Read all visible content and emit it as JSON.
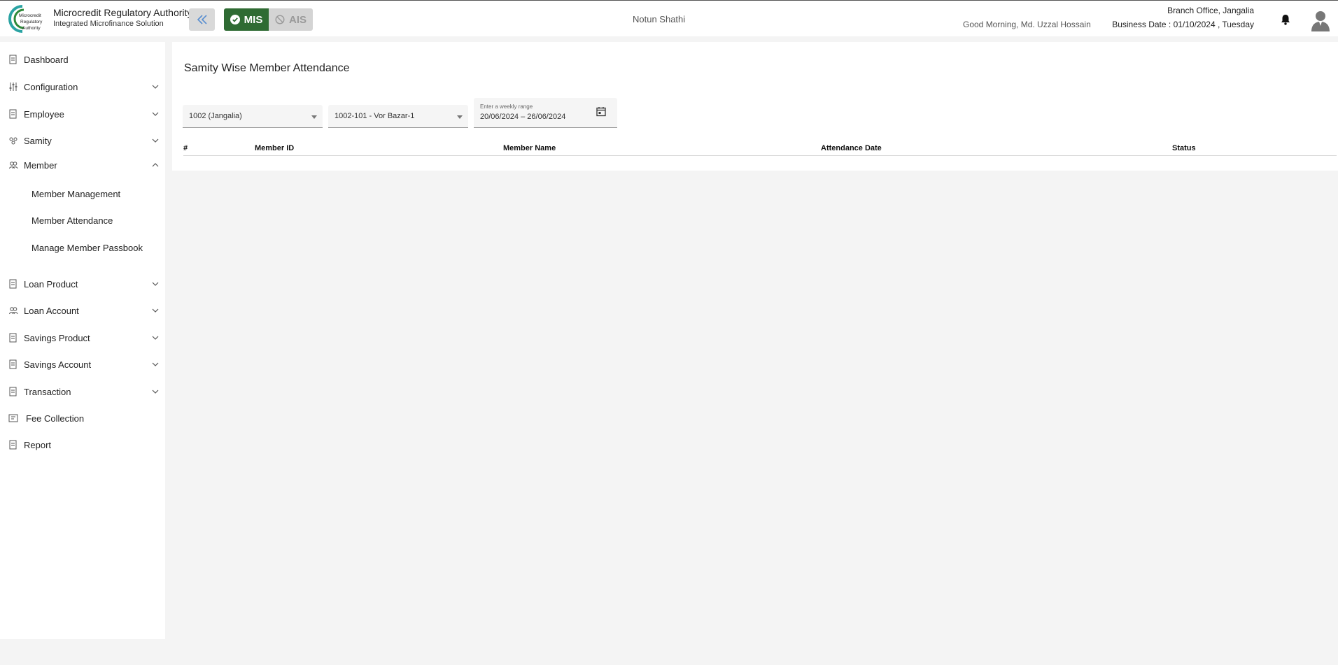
{
  "header": {
    "brand_title": "Microcredit Regulatory Authority",
    "brand_subtitle": "Integrated Microfinance Solution",
    "logo_text": [
      "Microcredit",
      "Regulatory",
      "Authority"
    ],
    "mode_mis": "MIS",
    "mode_ais": "AIS",
    "org_name": "Notun Shathi",
    "greeting": "Good Morning, Md. Uzzal Hossain",
    "branch": "Branch Office, Jangalia",
    "business_date": "Business Date : 01/10/2024 , Tuesday"
  },
  "sidebar": {
    "items": [
      {
        "label": "Dashboard"
      },
      {
        "label": "Configuration"
      },
      {
        "label": "Employee"
      },
      {
        "label": "Samity"
      },
      {
        "label": "Member"
      },
      {
        "label": "Loan Product"
      },
      {
        "label": "Loan Account"
      },
      {
        "label": "Savings Product"
      },
      {
        "label": "Savings Account"
      },
      {
        "label": "Transaction"
      },
      {
        "label": "Fee Collection"
      },
      {
        "label": "Report"
      }
    ],
    "member_sub": [
      {
        "label": "Member Management"
      },
      {
        "label": "Member Attendance"
      },
      {
        "label": "Manage Member Passbook"
      }
    ]
  },
  "main": {
    "title": "Samity Wise Member Attendance",
    "branch_select": "1002 (Jangalia)",
    "samity_select": "1002-101 - Vor Bazar-1",
    "date_label": "Enter a weekly range",
    "date_value": "20/06/2024 – 26/06/2024",
    "columns": [
      "#",
      "Member ID",
      "Member Name",
      "Attendance Date",
      "Status"
    ]
  },
  "colors": {
    "mis_active": "#2f6b33",
    "ais_inactive": "#d4d4d4",
    "logo_teal": "#2aa3a3",
    "logo_green": "#2f8a3a"
  }
}
